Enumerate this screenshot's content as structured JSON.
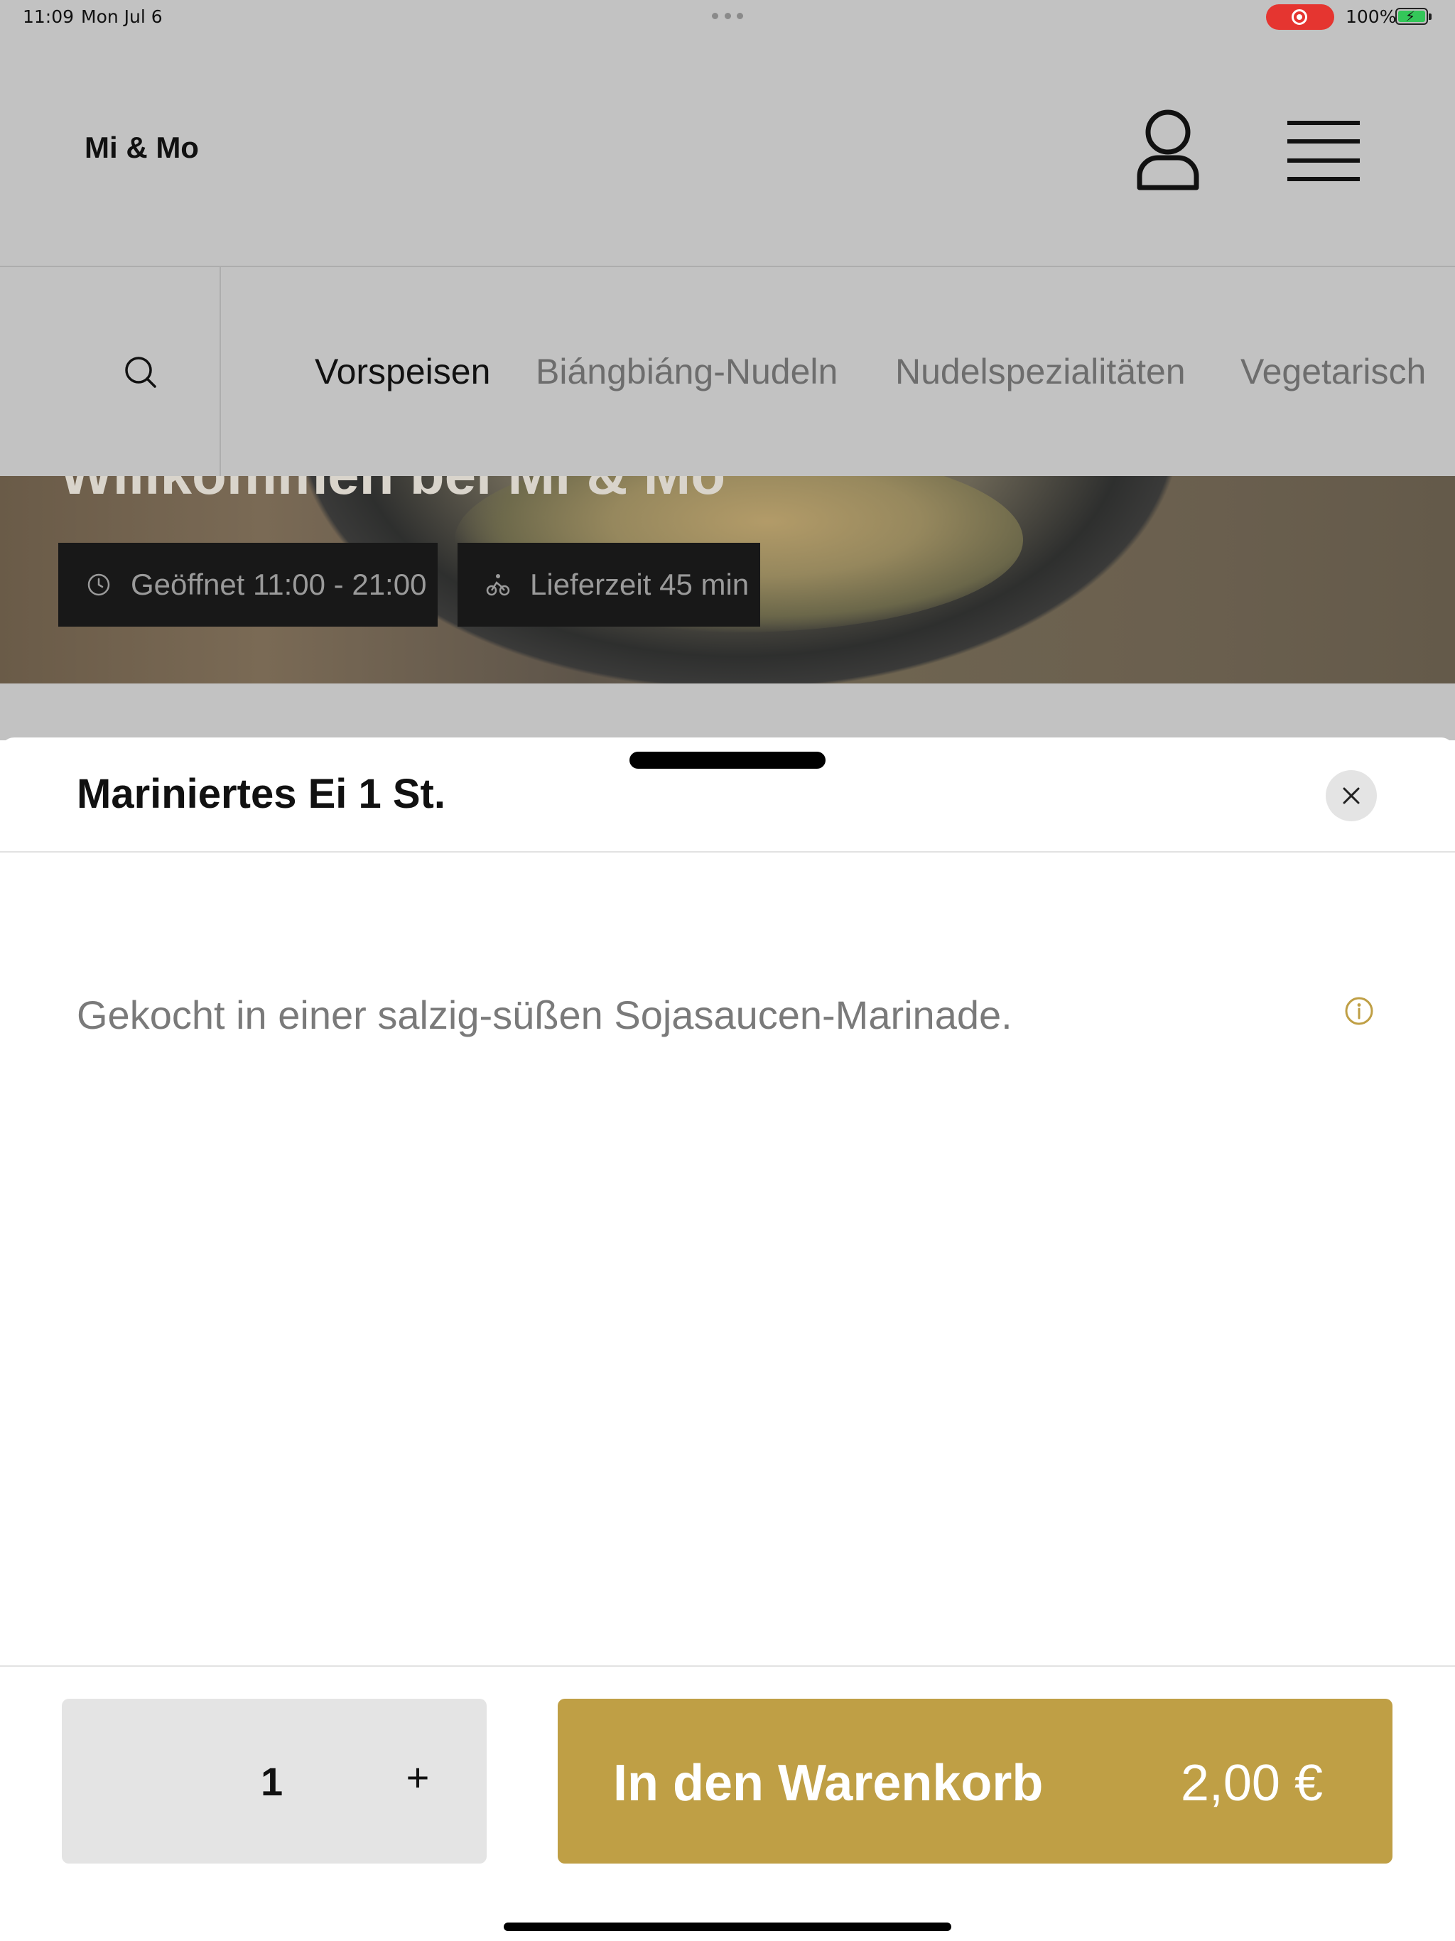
{
  "status_bar": {
    "time": "11:09",
    "date": "Mon Jul 6",
    "battery": "100%"
  },
  "header": {
    "brand": "Mi & Mo",
    "icons": [
      "user-icon",
      "menu-icon"
    ]
  },
  "categories": {
    "tabs": [
      {
        "label": "Vorspeisen",
        "active": true
      },
      {
        "label": "Biángbiáng-Nudeln",
        "active": false
      },
      {
        "label": "Nudelspezialitäten",
        "active": false
      },
      {
        "label": "Vegetarisch",
        "active": false
      }
    ]
  },
  "hero": {
    "title": "Willkommen bei Mi & Mo",
    "opening_hours": "Geöffnet 11:00 - 21:00",
    "delivery_time": "Lieferzeit 45 min"
  },
  "sheet": {
    "title": "Mariniertes Ei 1 St.",
    "description": "Gekocht in einer salzig-süßen Sojasaucen-Marinade.",
    "quantity": "1",
    "increment_label": "+",
    "add_to_cart_label": "In den Warenkorb",
    "price": "2,00 €"
  },
  "colors": {
    "accent": "#bf9f45",
    "recording": "#e53530",
    "overlay": "#c2c2c2"
  }
}
